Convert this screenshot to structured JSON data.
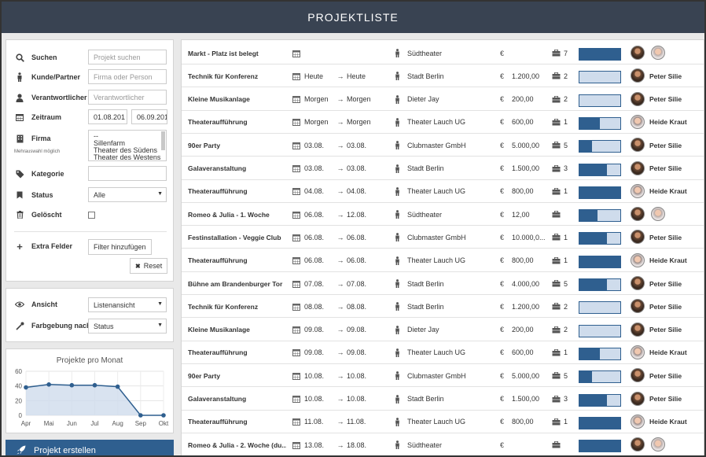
{
  "header": {
    "title": "PROJEKTLISTE"
  },
  "filter": {
    "search": {
      "label": "Suchen",
      "placeholder": "Projekt suchen"
    },
    "customer": {
      "label": "Kunde/Partner",
      "placeholder": "Firma oder Person"
    },
    "responsible": {
      "label": "Verantwortlicher",
      "placeholder": "Verantwortlicher"
    },
    "period": {
      "label": "Zeitraum",
      "from": "01.08.201",
      "to": "06.09.201"
    },
    "company": {
      "label": "Firma",
      "note": "Mehrauswahl möglich",
      "options": [
        "--",
        "Sillenfarm",
        "Theater des Südens",
        "Theater des Westens"
      ]
    },
    "category": {
      "label": "Kategorie",
      "value": ""
    },
    "status": {
      "label": "Status",
      "value": "Alle"
    },
    "deleted": {
      "label": "Gelöscht"
    },
    "extra": {
      "label": "Extra Felder",
      "button": "Filter hinzufügen"
    },
    "reset": "Reset"
  },
  "view": {
    "mode": {
      "label": "Ansicht",
      "value": "Listenansicht"
    },
    "color": {
      "label": "Farbgebung nach",
      "value": "Status"
    }
  },
  "chart_data": {
    "type": "line",
    "title": "Projekte pro Monat",
    "categories": [
      "Apr",
      "Mai",
      "Jun",
      "Jul",
      "Aug",
      "Sep",
      "Okt"
    ],
    "values": [
      38,
      42,
      41,
      41,
      39,
      0,
      0
    ],
    "yticks": [
      0,
      20,
      40,
      60
    ],
    "ylim": [
      0,
      60
    ],
    "grid": true,
    "colors": {
      "line": "#2f5f8f",
      "fill": "#cfdcec"
    }
  },
  "create_button": "Projekt erstellen",
  "icons": {
    "calendar": "calendar-icon",
    "arrow": "→",
    "person": "person-icon",
    "euro": "€",
    "briefcase": "briefcase-icon"
  },
  "projects": [
    {
      "name": "Markt - Platz ist belegt",
      "start": "",
      "end": "",
      "customer": "Südtheater",
      "amount": "",
      "count": "7",
      "progress": 1.0,
      "avatars": 2,
      "resp": ""
    },
    {
      "name": "Technik für Konferenz",
      "start": "Heute",
      "end": "Heute",
      "customer": "Stadt Berlin",
      "amount": "1.200,00",
      "count": "2",
      "progress": 0.0,
      "avatars": 1,
      "resp": "Peter Silie"
    },
    {
      "name": "Kleine Musikanlage",
      "start": "Morgen",
      "end": "Morgen",
      "customer": "Dieter Jay",
      "amount": "200,00",
      "count": "2",
      "progress": 0.0,
      "avatars": 1,
      "resp": "Peter Silie"
    },
    {
      "name": "Theateraufführung",
      "start": "Morgen",
      "end": "Morgen",
      "customer": "Theater Lauch UG",
      "amount": "600,00",
      "count": "1",
      "progress": 0.5,
      "avatars": 1,
      "resp": "Heide Kraut",
      "f": true
    },
    {
      "name": "90er Party",
      "start": "03.08.",
      "end": "03.08.",
      "customer": "Clubmaster GmbH",
      "amount": "5.000,00",
      "count": "5",
      "progress": 0.3,
      "avatars": 1,
      "resp": "Peter Silie"
    },
    {
      "name": "Galaveranstaltung",
      "start": "03.08.",
      "end": "03.08.",
      "customer": "Stadt Berlin",
      "amount": "1.500,00",
      "count": "3",
      "progress": 0.68,
      "avatars": 1,
      "resp": "Peter Silie"
    },
    {
      "name": "Theateraufführung",
      "start": "04.08.",
      "end": "04.08.",
      "customer": "Theater Lauch UG",
      "amount": "800,00",
      "count": "1",
      "progress": 1.0,
      "avatars": 1,
      "resp": "Heide Kraut",
      "f": true
    },
    {
      "name": "Romeo & Julia - 1. Woche",
      "start": "06.08.",
      "end": "12.08.",
      "customer": "Südtheater",
      "amount": "12,00",
      "count": "",
      "progress": 0.45,
      "avatars": 2,
      "resp": ""
    },
    {
      "name": "Festinstallation - Veggie Club",
      "start": "06.08.",
      "end": "06.08.",
      "customer": "Clubmaster GmbH",
      "amount": "10.000,0...",
      "count": "1",
      "progress": 0.68,
      "avatars": 1,
      "resp": "Peter Silie"
    },
    {
      "name": "Theateraufführung",
      "start": "06.08.",
      "end": "06.08.",
      "customer": "Theater Lauch UG",
      "amount": "800,00",
      "count": "1",
      "progress": 1.0,
      "avatars": 1,
      "resp": "Heide Kraut",
      "f": true
    },
    {
      "name": "Bühne am Brandenburger Tor",
      "start": "07.08.",
      "end": "07.08.",
      "customer": "Stadt Berlin",
      "amount": "4.000,00",
      "count": "5",
      "progress": 0.68,
      "avatars": 1,
      "resp": "Peter Silie"
    },
    {
      "name": "Technik für Konferenz",
      "start": "08.08.",
      "end": "08.08.",
      "customer": "Stadt Berlin",
      "amount": "1.200,00",
      "count": "2",
      "progress": 0.0,
      "avatars": 1,
      "resp": "Peter Silie"
    },
    {
      "name": "Kleine Musikanlage",
      "start": "09.08.",
      "end": "09.08.",
      "customer": "Dieter Jay",
      "amount": "200,00",
      "count": "2",
      "progress": 0.0,
      "avatars": 1,
      "resp": "Peter Silie"
    },
    {
      "name": "Theateraufführung",
      "start": "09.08.",
      "end": "09.08.",
      "customer": "Theater Lauch UG",
      "amount": "600,00",
      "count": "1",
      "progress": 0.5,
      "avatars": 1,
      "resp": "Heide Kraut",
      "f": true
    },
    {
      "name": "90er Party",
      "start": "10.08.",
      "end": "10.08.",
      "customer": "Clubmaster GmbH",
      "amount": "5.000,00",
      "count": "5",
      "progress": 0.3,
      "avatars": 1,
      "resp": "Peter Silie"
    },
    {
      "name": "Galaveranstaltung",
      "start": "10.08.",
      "end": "10.08.",
      "customer": "Stadt Berlin",
      "amount": "1.500,00",
      "count": "3",
      "progress": 0.68,
      "avatars": 1,
      "resp": "Peter Silie"
    },
    {
      "name": "Theateraufführung",
      "start": "11.08.",
      "end": "11.08.",
      "customer": "Theater Lauch UG",
      "amount": "800,00",
      "count": "1",
      "progress": 1.0,
      "avatars": 1,
      "resp": "Heide Kraut",
      "f": true
    },
    {
      "name": "Romeo & Julia - 2. Woche (du...",
      "start": "13.08.",
      "end": "18.08.",
      "customer": "Südtheater",
      "amount": "",
      "count": "",
      "progress": 1.0,
      "avatars": 2,
      "resp": ""
    }
  ]
}
